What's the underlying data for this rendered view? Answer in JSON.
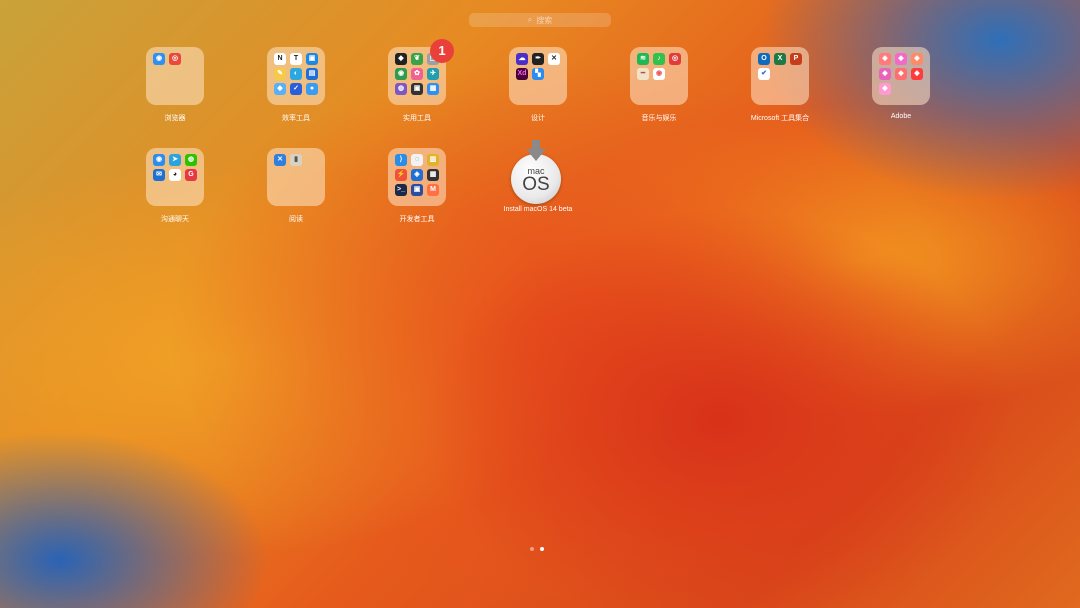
{
  "search": {
    "placeholder": "搜索",
    "icon": "magnifier-icon"
  },
  "folders_row1": [
    {
      "label": "浏览器",
      "badge": null,
      "icons": [
        {
          "name": "safari-icon",
          "color": "#2f8ff2",
          "glyph": "◉"
        },
        {
          "name": "chrome-icon",
          "color": "#e9483b",
          "glyph": "◎"
        }
      ]
    },
    {
      "label": "效率工具",
      "badge": null,
      "icons": [
        {
          "name": "notion-icon",
          "color": "#ffffff",
          "glyph": "N",
          "text": "#222"
        },
        {
          "name": "typora-icon",
          "color": "#ffffff",
          "glyph": "T",
          "text": "#222"
        },
        {
          "name": "app-icon-blue",
          "color": "#1e88e5",
          "glyph": "▣"
        },
        {
          "name": "pencil-icon",
          "color": "#f7c948",
          "glyph": "✎"
        },
        {
          "name": "app-icon-cyan",
          "color": "#2ca8e0",
          "glyph": "◐"
        },
        {
          "name": "app-icon-blue2",
          "color": "#1f6fd6",
          "glyph": "▤"
        },
        {
          "name": "app-icon-lightblue",
          "color": "#5ab0f5",
          "glyph": "◆"
        },
        {
          "name": "app-icon-navy",
          "color": "#2b5fd9",
          "glyph": "✓"
        },
        {
          "name": "app-icon-sky",
          "color": "#3a9cf0",
          "glyph": "●"
        }
      ]
    },
    {
      "label": "实用工具",
      "badge": "1",
      "icons": [
        {
          "name": "shield-icon",
          "color": "#222222",
          "glyph": "◆"
        },
        {
          "name": "leaf-icon",
          "color": "#3ca24a",
          "glyph": "❦"
        },
        {
          "name": "app-icon-gray",
          "color": "#9aa0a6",
          "glyph": "▢"
        },
        {
          "name": "app-icon-green",
          "color": "#2e9b4e",
          "glyph": "◉"
        },
        {
          "name": "app-icon-pink",
          "color": "#f06292",
          "glyph": "✿"
        },
        {
          "name": "app-icon-teal",
          "color": "#1f9fb0",
          "glyph": "✈"
        },
        {
          "name": "app-icon-purple",
          "color": "#7e57c2",
          "glyph": "◍"
        },
        {
          "name": "app-icon-dark",
          "color": "#333333",
          "glyph": "▣"
        },
        {
          "name": "app-icon-blue",
          "color": "#2f8ff2",
          "glyph": "▦"
        }
      ]
    },
    {
      "label": "设计",
      "badge": null,
      "icons": [
        {
          "name": "creative-cloud-icon",
          "color": "#4b2fc9",
          "glyph": "☁"
        },
        {
          "name": "pen-tool-icon",
          "color": "#222222",
          "glyph": "✒"
        },
        {
          "name": "figma-icon",
          "color": "#ffffff",
          "glyph": "✕",
          "text": "#222"
        },
        {
          "name": "xd-icon",
          "color": "#470137",
          "glyph": "Xd",
          "text": "#ff61f6"
        },
        {
          "name": "app-icon-blue",
          "color": "#2d8cf0",
          "glyph": "▚"
        }
      ]
    },
    {
      "label": "音乐与娱乐",
      "badge": null,
      "icons": [
        {
          "name": "spotify-icon",
          "color": "#1db954",
          "glyph": "≋"
        },
        {
          "name": "music-green-icon",
          "color": "#31c24d",
          "glyph": "♪"
        },
        {
          "name": "netease-music-icon",
          "color": "#e23b3b",
          "glyph": "◎"
        },
        {
          "name": "app-icon-beige",
          "color": "#f2e3c8",
          "glyph": "━",
          "text": "#a55"
        },
        {
          "name": "app-icon-white",
          "color": "#ffffff",
          "glyph": "◉",
          "text": "#e55"
        }
      ]
    },
    {
      "label": "Microsoft 工具集合",
      "badge": null,
      "icons": [
        {
          "name": "outlook-icon",
          "color": "#0f6cbd",
          "glyph": "O"
        },
        {
          "name": "excel-icon",
          "color": "#1d7a45",
          "glyph": "X"
        },
        {
          "name": "powerpoint-icon",
          "color": "#c43e1c",
          "glyph": "P"
        },
        {
          "name": "todo-icon",
          "color": "#ffffff",
          "glyph": "✔",
          "text": "#2a6fd8"
        }
      ]
    },
    {
      "label": "Adobe",
      "badge": null,
      "icons": [
        {
          "name": "adobe-app-icon",
          "color": "#ff7a7a",
          "glyph": "◆"
        },
        {
          "name": "adobe-app-icon",
          "color": "#f06ac8",
          "glyph": "◆"
        },
        {
          "name": "adobe-app-icon",
          "color": "#ff8a6a",
          "glyph": "◆"
        },
        {
          "name": "adobe-app-icon",
          "color": "#e864b8",
          "glyph": "◆"
        },
        {
          "name": "adobe-app-icon",
          "color": "#ff6f6f",
          "glyph": "◆"
        },
        {
          "name": "adobe-app-icon",
          "color": "#ff3b3b",
          "glyph": "◆"
        },
        {
          "name": "adobe-app-icon",
          "color": "#ff9ad1",
          "glyph": "◆"
        }
      ]
    }
  ],
  "folders_row2": [
    {
      "label": "沟通聊天",
      "badge": null,
      "icons": [
        {
          "name": "app-icon-blue",
          "color": "#2d8cf0",
          "glyph": "◉"
        },
        {
          "name": "telegram-icon",
          "color": "#2aa3e0",
          "glyph": "➤"
        },
        {
          "name": "wechat-icon",
          "color": "#2dc100",
          "glyph": "◍"
        },
        {
          "name": "app-icon-navy",
          "color": "#1e6fd6",
          "glyph": "✉"
        },
        {
          "name": "qq-icon",
          "color": "#ffffff",
          "glyph": "◕",
          "text": "#222"
        },
        {
          "name": "app-icon-red",
          "color": "#e53945",
          "glyph": "G"
        }
      ]
    },
    {
      "label": "阅读",
      "badge": null,
      "icons": [
        {
          "name": "app-icon-blue",
          "color": "#2f7fe0",
          "glyph": "✕"
        },
        {
          "name": "book-icon",
          "color": "#d9d2c2",
          "glyph": "▮",
          "text": "#555"
        }
      ]
    },
    {
      "label": "开发者工具",
      "badge": null,
      "icons": [
        {
          "name": "vscode-icon",
          "color": "#2a8ee8",
          "glyph": "⟩"
        },
        {
          "name": "app-icon-white",
          "color": "#f2f2f2",
          "glyph": "◌",
          "text": "#555"
        },
        {
          "name": "app-icon-yellow",
          "color": "#e0b32c",
          "glyph": "▥"
        },
        {
          "name": "swift-icon",
          "color": "#f05138",
          "glyph": "⚡"
        },
        {
          "name": "app-icon-blue",
          "color": "#1f6fd6",
          "glyph": "◈"
        },
        {
          "name": "app-icon-dark",
          "color": "#333333",
          "glyph": "▦"
        },
        {
          "name": "terminal-icon",
          "color": "#1c2a4a",
          "glyph": ">_"
        },
        {
          "name": "app-icon-navy",
          "color": "#2b4ea0",
          "glyph": "▣"
        },
        {
          "name": "app-icon-orange",
          "color": "#ff7043",
          "glyph": "M"
        }
      ]
    }
  ],
  "installer": {
    "label": "Install macOS 14 beta",
    "disc_line1": "mac",
    "disc_line2": "OS",
    "icon": "macos-installer-icon"
  },
  "page_dots": {
    "count": 2,
    "active_index": 1
  }
}
